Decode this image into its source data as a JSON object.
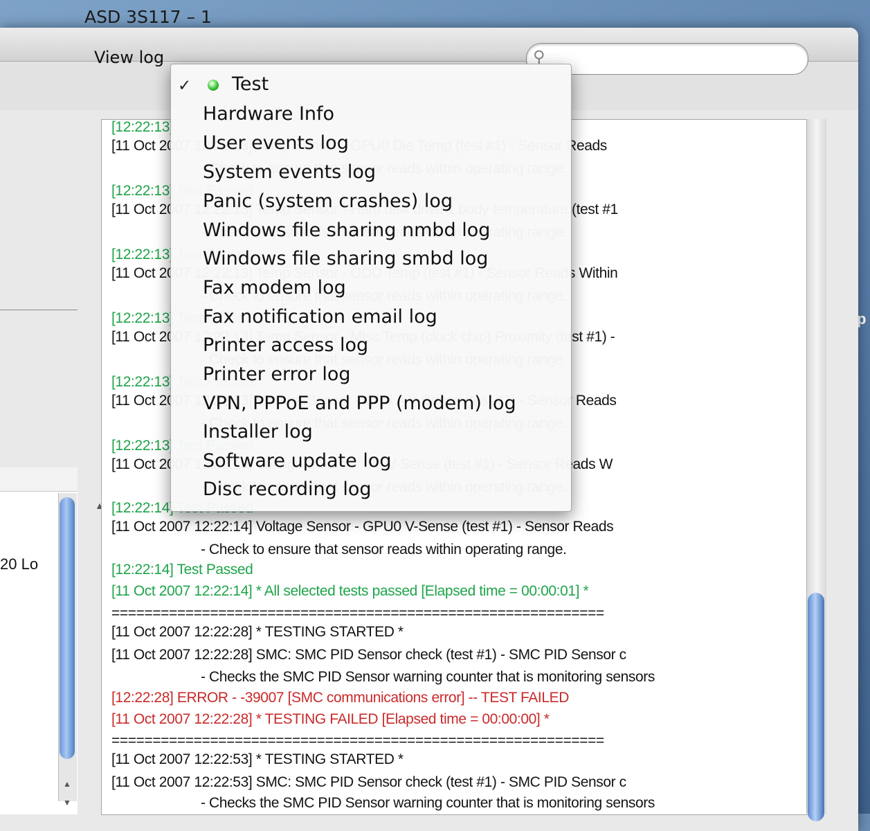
{
  "window": {
    "title": "ASD 3S117 – 1"
  },
  "toolbar": {
    "view_log_label": "View log"
  },
  "desktop": {
    "edge_text": "p"
  },
  "left_panel": {
    "visible_text": "20 Lo"
  },
  "menu": {
    "items": [
      {
        "label": "Test",
        "checked": true,
        "status_color": "#38c238"
      },
      {
        "label": "Hardware Info"
      },
      {
        "label": "User events log"
      },
      {
        "label": "System events log"
      },
      {
        "label": "Panic (system crashes) log"
      },
      {
        "label": "Windows file sharing nmbd log"
      },
      {
        "label": "Windows file sharing smbd log"
      },
      {
        "label": "Fax modem log"
      },
      {
        "label": "Fax notification email log"
      },
      {
        "label": "Printer access log"
      },
      {
        "label": "Printer error log"
      },
      {
        "label": "VPN, PPPoE and PPP (modem) log"
      },
      {
        "label": "Installer log"
      },
      {
        "label": "Software update log"
      },
      {
        "label": "Disc recording log"
      }
    ]
  },
  "log": {
    "lines": [
      {
        "text": "[12:22:13]",
        "style": "green"
      },
      {
        "text": "[11 Oct 2007 12:22:13]   Temp Sensor - GPU0 Die Temp (test #1) - Sensor Reads",
        "style": "normal"
      },
      {
        "text": "- Check to ensure that sensor reads within operating range.",
        "style": "indent"
      },
      {
        "text": "[12:22:13]        Test Passed",
        "style": "green"
      },
      {
        "text": "[11 Oct 2007 12:22:13]   Temp Sensor - Hard disk drive 1 body temperature (test #1",
        "style": "normal"
      },
      {
        "text": "- Check to ensure that sensor reads within operating range.",
        "style": "indent"
      },
      {
        "text": "[12:22:13]        Test Passed",
        "style": "green"
      },
      {
        "text": "[11 Oct 2007 12:22:13]   Temp Sensor - ODD Temp (test #1) - Sensor Reads Within",
        "style": "normal"
      },
      {
        "text": "- Check to ensure that sensor reads within operating range.",
        "style": "indent"
      },
      {
        "text": "[12:22:13]        Test Passed",
        "style": "green"
      },
      {
        "text": "[11 Oct 2007 12:22:13]   Temp Sensor - Misc Temp (clock chip) Proximity (test #1) -",
        "style": "normal"
      },
      {
        "text": "- Check to ensure that sensor reads within operating range.",
        "style": "indent"
      },
      {
        "text": "[12:22:13]        Test Passed",
        "style": "green"
      },
      {
        "text": "[11 Oct 2007 12:22:13]   Voltage Sensor - CPU A V-Sense (test #1) - Sensor Reads",
        "style": "normal"
      },
      {
        "text": "- Check to ensure that sensor reads within operating range.",
        "style": "indent"
      },
      {
        "text": "[12:22:13]        Test Passed",
        "style": "green"
      },
      {
        "text": "[11 Oct 2007 12:22:13]   Voltage Sensor - DC V-Sense (test #1) - Sensor Reads W",
        "style": "normal"
      },
      {
        "text": "- Check to ensure that sensor reads within operating range.",
        "style": "indent"
      },
      {
        "text": "[12:22:14]        Test Passed",
        "style": "green"
      },
      {
        "text": "[11 Oct 2007 12:22:14]     Voltage Sensor - GPU0  V-Sense (test #1) - Sensor Reads",
        "style": "normal"
      },
      {
        "text": "- Check to ensure that sensor reads within operating range.",
        "style": "indent"
      },
      {
        "text": "[12:22:14]        Test Passed",
        "style": "green"
      },
      {
        "text": "[11 Oct 2007 12:22:14] * All selected tests passed [Elapsed time = 00:00:01] *",
        "style": "green"
      },
      {
        "text": "============================================================",
        "style": "normal"
      },
      {
        "text": "[11 Oct 2007 12:22:28] * TESTING STARTED *",
        "style": "normal"
      },
      {
        "text": "[11 Oct 2007 12:22:28]     SMC: SMC PID Sensor check (test #1) - SMC PID Sensor c",
        "style": "normal"
      },
      {
        "text": "- Checks the SMC PID Sensor warning counter that is monitoring sensors",
        "style": "indent"
      },
      {
        "text": "[12:22:28]        ERROR - -39007 [SMC communications error] -- TEST FAILED",
        "style": "red"
      },
      {
        "text": "[11 Oct 2007 12:22:28] * TESTING FAILED [Elapsed time = 00:00:00]  *",
        "style": "red"
      },
      {
        "text": "============================================================",
        "style": "normal"
      },
      {
        "text": "[11 Oct 2007 12:22:53] * TESTING STARTED *",
        "style": "normal"
      },
      {
        "text": "[11 Oct 2007 12:22:53]     SMC: SMC PID Sensor check (test #1) - SMC PID Sensor c",
        "style": "normal"
      },
      {
        "text": "- Checks the SMC PID Sensor warning counter that is monitoring sensors",
        "style": "indent"
      }
    ]
  },
  "colors": {
    "pass": "#1fa44a",
    "fail": "#c92a2a",
    "accent": "#5b8bd0"
  }
}
